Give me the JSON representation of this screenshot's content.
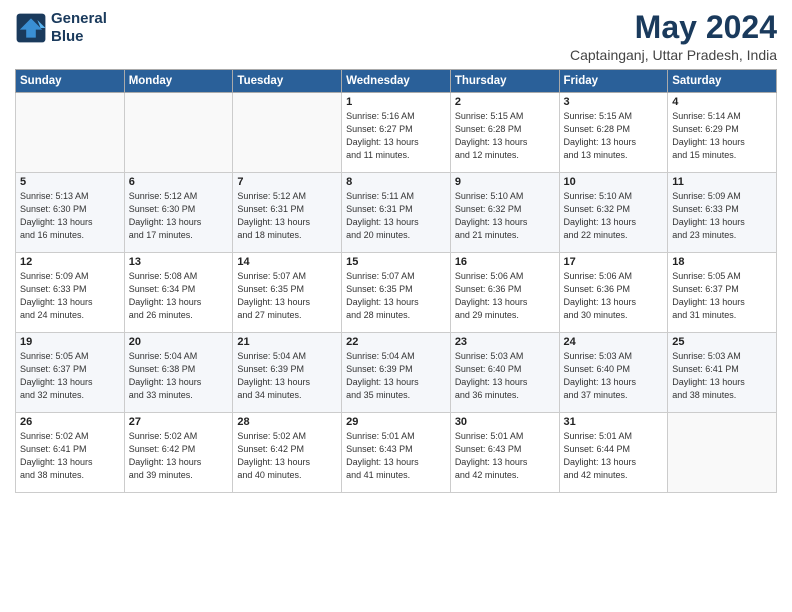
{
  "header": {
    "logo_line1": "General",
    "logo_line2": "Blue",
    "month_title": "May 2024",
    "location": "Captainganj, Uttar Pradesh, India"
  },
  "days_of_week": [
    "Sunday",
    "Monday",
    "Tuesday",
    "Wednesday",
    "Thursday",
    "Friday",
    "Saturday"
  ],
  "weeks": [
    [
      {
        "day": "",
        "info": ""
      },
      {
        "day": "",
        "info": ""
      },
      {
        "day": "",
        "info": ""
      },
      {
        "day": "1",
        "info": "Sunrise: 5:16 AM\nSunset: 6:27 PM\nDaylight: 13 hours\nand 11 minutes."
      },
      {
        "day": "2",
        "info": "Sunrise: 5:15 AM\nSunset: 6:28 PM\nDaylight: 13 hours\nand 12 minutes."
      },
      {
        "day": "3",
        "info": "Sunrise: 5:15 AM\nSunset: 6:28 PM\nDaylight: 13 hours\nand 13 minutes."
      },
      {
        "day": "4",
        "info": "Sunrise: 5:14 AM\nSunset: 6:29 PM\nDaylight: 13 hours\nand 15 minutes."
      }
    ],
    [
      {
        "day": "5",
        "info": "Sunrise: 5:13 AM\nSunset: 6:30 PM\nDaylight: 13 hours\nand 16 minutes."
      },
      {
        "day": "6",
        "info": "Sunrise: 5:12 AM\nSunset: 6:30 PM\nDaylight: 13 hours\nand 17 minutes."
      },
      {
        "day": "7",
        "info": "Sunrise: 5:12 AM\nSunset: 6:31 PM\nDaylight: 13 hours\nand 18 minutes."
      },
      {
        "day": "8",
        "info": "Sunrise: 5:11 AM\nSunset: 6:31 PM\nDaylight: 13 hours\nand 20 minutes."
      },
      {
        "day": "9",
        "info": "Sunrise: 5:10 AM\nSunset: 6:32 PM\nDaylight: 13 hours\nand 21 minutes."
      },
      {
        "day": "10",
        "info": "Sunrise: 5:10 AM\nSunset: 6:32 PM\nDaylight: 13 hours\nand 22 minutes."
      },
      {
        "day": "11",
        "info": "Sunrise: 5:09 AM\nSunset: 6:33 PM\nDaylight: 13 hours\nand 23 minutes."
      }
    ],
    [
      {
        "day": "12",
        "info": "Sunrise: 5:09 AM\nSunset: 6:33 PM\nDaylight: 13 hours\nand 24 minutes."
      },
      {
        "day": "13",
        "info": "Sunrise: 5:08 AM\nSunset: 6:34 PM\nDaylight: 13 hours\nand 26 minutes."
      },
      {
        "day": "14",
        "info": "Sunrise: 5:07 AM\nSunset: 6:35 PM\nDaylight: 13 hours\nand 27 minutes."
      },
      {
        "day": "15",
        "info": "Sunrise: 5:07 AM\nSunset: 6:35 PM\nDaylight: 13 hours\nand 28 minutes."
      },
      {
        "day": "16",
        "info": "Sunrise: 5:06 AM\nSunset: 6:36 PM\nDaylight: 13 hours\nand 29 minutes."
      },
      {
        "day": "17",
        "info": "Sunrise: 5:06 AM\nSunset: 6:36 PM\nDaylight: 13 hours\nand 30 minutes."
      },
      {
        "day": "18",
        "info": "Sunrise: 5:05 AM\nSunset: 6:37 PM\nDaylight: 13 hours\nand 31 minutes."
      }
    ],
    [
      {
        "day": "19",
        "info": "Sunrise: 5:05 AM\nSunset: 6:37 PM\nDaylight: 13 hours\nand 32 minutes."
      },
      {
        "day": "20",
        "info": "Sunrise: 5:04 AM\nSunset: 6:38 PM\nDaylight: 13 hours\nand 33 minutes."
      },
      {
        "day": "21",
        "info": "Sunrise: 5:04 AM\nSunset: 6:39 PM\nDaylight: 13 hours\nand 34 minutes."
      },
      {
        "day": "22",
        "info": "Sunrise: 5:04 AM\nSunset: 6:39 PM\nDaylight: 13 hours\nand 35 minutes."
      },
      {
        "day": "23",
        "info": "Sunrise: 5:03 AM\nSunset: 6:40 PM\nDaylight: 13 hours\nand 36 minutes."
      },
      {
        "day": "24",
        "info": "Sunrise: 5:03 AM\nSunset: 6:40 PM\nDaylight: 13 hours\nand 37 minutes."
      },
      {
        "day": "25",
        "info": "Sunrise: 5:03 AM\nSunset: 6:41 PM\nDaylight: 13 hours\nand 38 minutes."
      }
    ],
    [
      {
        "day": "26",
        "info": "Sunrise: 5:02 AM\nSunset: 6:41 PM\nDaylight: 13 hours\nand 38 minutes."
      },
      {
        "day": "27",
        "info": "Sunrise: 5:02 AM\nSunset: 6:42 PM\nDaylight: 13 hours\nand 39 minutes."
      },
      {
        "day": "28",
        "info": "Sunrise: 5:02 AM\nSunset: 6:42 PM\nDaylight: 13 hours\nand 40 minutes."
      },
      {
        "day": "29",
        "info": "Sunrise: 5:01 AM\nSunset: 6:43 PM\nDaylight: 13 hours\nand 41 minutes."
      },
      {
        "day": "30",
        "info": "Sunrise: 5:01 AM\nSunset: 6:43 PM\nDaylight: 13 hours\nand 42 minutes."
      },
      {
        "day": "31",
        "info": "Sunrise: 5:01 AM\nSunset: 6:44 PM\nDaylight: 13 hours\nand 42 minutes."
      },
      {
        "day": "",
        "info": ""
      }
    ]
  ]
}
